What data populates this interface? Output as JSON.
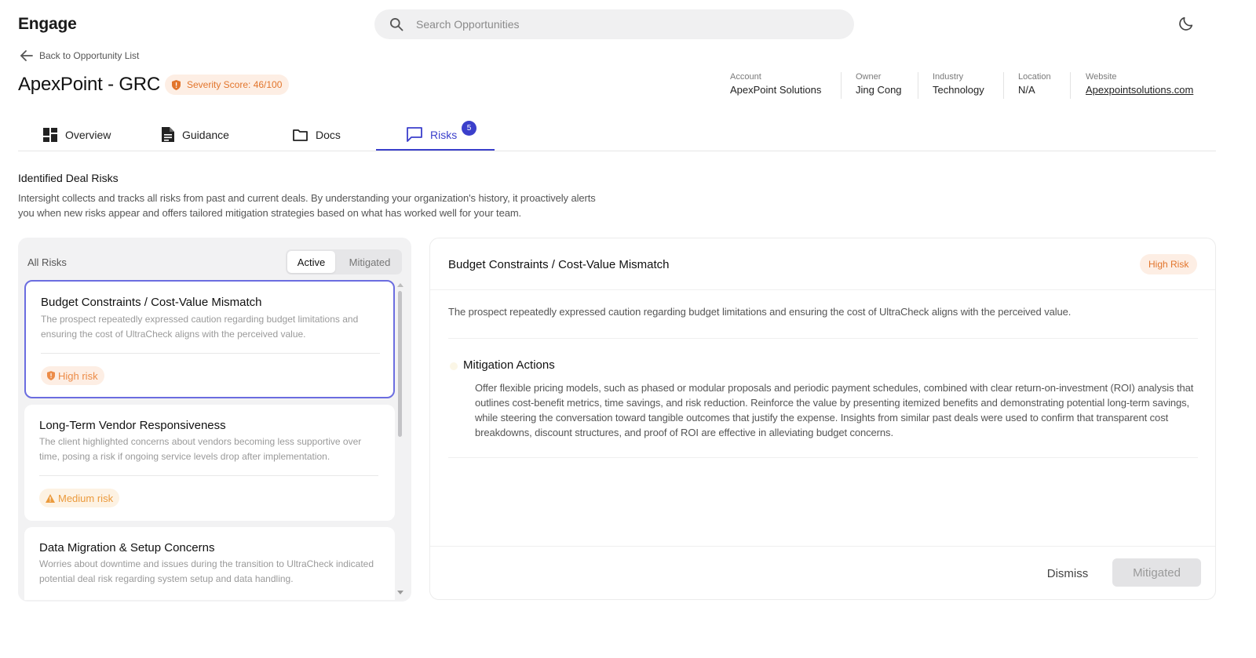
{
  "app": {
    "brand": "Engage"
  },
  "search": {
    "placeholder": "Search Opportunities"
  },
  "nav": {
    "back_label": "Back to Opportunity List"
  },
  "opportunity": {
    "title": "ApexPoint - GRC",
    "severity_label": "Severity Score: 46/100",
    "meta": {
      "account": {
        "label": "Account",
        "value": "ApexPoint Solutions"
      },
      "owner": {
        "label": "Owner",
        "value": "Jing Cong"
      },
      "industry": {
        "label": "Industry",
        "value": "Technology"
      },
      "location": {
        "label": "Location",
        "value": "N/A"
      },
      "website": {
        "label": "Website",
        "value": "Apexpointsolutions.com"
      }
    }
  },
  "tabs": {
    "overview": "Overview",
    "guidance": "Guidance",
    "docs": "Docs",
    "risks": "Risks",
    "risks_count": "5",
    "active": "risks"
  },
  "section": {
    "title": "Identified Deal Risks",
    "description": "Intersight collects and tracks all risks from past and current deals. By understanding your organization's history, it proactively alerts you when new risks appear and offers tailored mitigation strategies based on what has worked well for your team."
  },
  "risk_list": {
    "header": "All Risks",
    "filter_active": "Active",
    "filter_mitigated": "Mitigated",
    "items": [
      {
        "title": "Budget Constraints / Cost-Value Mismatch",
        "description": "The prospect repeatedly expressed caution regarding budget limitations and ensuring the cost of UltraCheck aligns with the perceived value.",
        "badge": "High risk",
        "level": "high"
      },
      {
        "title": "Long-Term Vendor Responsiveness",
        "description": "The client highlighted concerns about vendors becoming less supportive over time, posing a risk if ongoing service levels drop after implementation.",
        "badge": "Medium risk",
        "level": "medium"
      },
      {
        "title": "Data Migration & Setup Concerns",
        "description": "Worries about downtime and issues during the transition to UltraCheck indicated potential deal risk regarding system setup and data handling.",
        "badge": "",
        "level": ""
      }
    ]
  },
  "detail": {
    "title": "Budget Constraints / Cost-Value Mismatch",
    "badge": "High Risk",
    "description": "The prospect repeatedly expressed caution regarding budget limitations and ensuring the cost of UltraCheck aligns with the perceived value.",
    "mitigation_title": "Mitigation Actions",
    "mitigation_text": "Offer flexible pricing models, such as phased or modular proposals and periodic payment schedules, combined with clear return-on-investment (ROI) analysis that outlines cost-benefit metrics, time savings, and risk reduction. Reinforce the value by presenting itemized benefits and demonstrating potential long-term savings, while steering the conversation toward tangible outcomes that justify the expense. Insights from similar past deals were used to confirm that transparent cost breakdowns, discount structures, and proof of ROI are effective in alleviating budget concerns.",
    "dismiss_label": "Dismiss",
    "mitigated_label": "Mitigated"
  },
  "colors": {
    "accent": "#3b3fcb",
    "high_risk": "#e2752c",
    "medium_risk": "#eb9a3c"
  }
}
